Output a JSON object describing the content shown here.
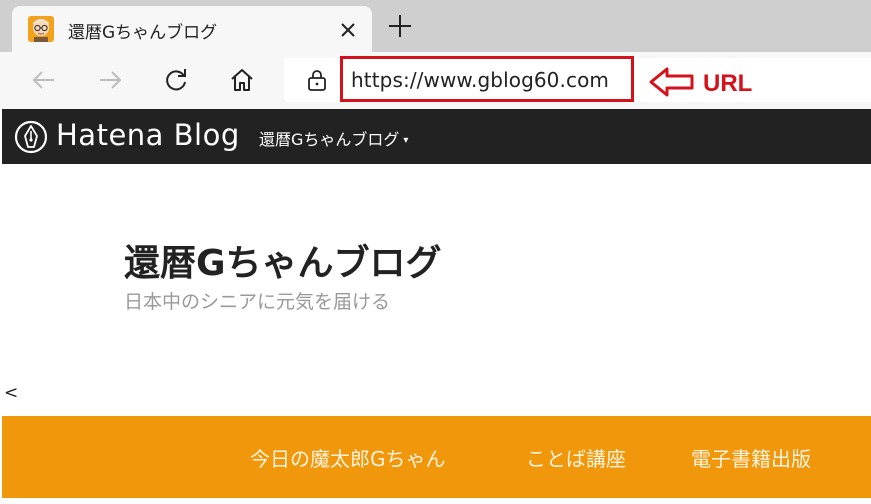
{
  "browser": {
    "tab": {
      "title": "還暦Gちゃんブログ",
      "close_icon": "close-icon"
    },
    "new_tab_icon": "plus-icon",
    "toolbar": {
      "back_icon": "arrow-left-icon",
      "forward_icon": "arrow-right-icon",
      "reload_icon": "reload-icon",
      "home_icon": "home-icon",
      "lock_icon": "lock-icon"
    },
    "address_bar": {
      "url": "https://www.gblog60.com"
    }
  },
  "annotation": {
    "label": "URL",
    "color": "#d3121c",
    "arrow_icon": "arrow-left-outline-icon"
  },
  "hatena_bar": {
    "logo_text": "Hatena Blog",
    "blog_menu_label": "還暦Gちゃんブログ",
    "menu_caret": "▾",
    "background": "#222222"
  },
  "blog_header": {
    "title": "還暦Gちゃんブログ",
    "description": "日本中のシニアに元気を届ける"
  },
  "stray_text": "<",
  "global_nav": {
    "background": "#f0970b",
    "items": [
      {
        "label": "今日の魔太郎Gちゃん"
      },
      {
        "label": "ことば講座"
      },
      {
        "label": "電子書籍出版"
      }
    ]
  }
}
